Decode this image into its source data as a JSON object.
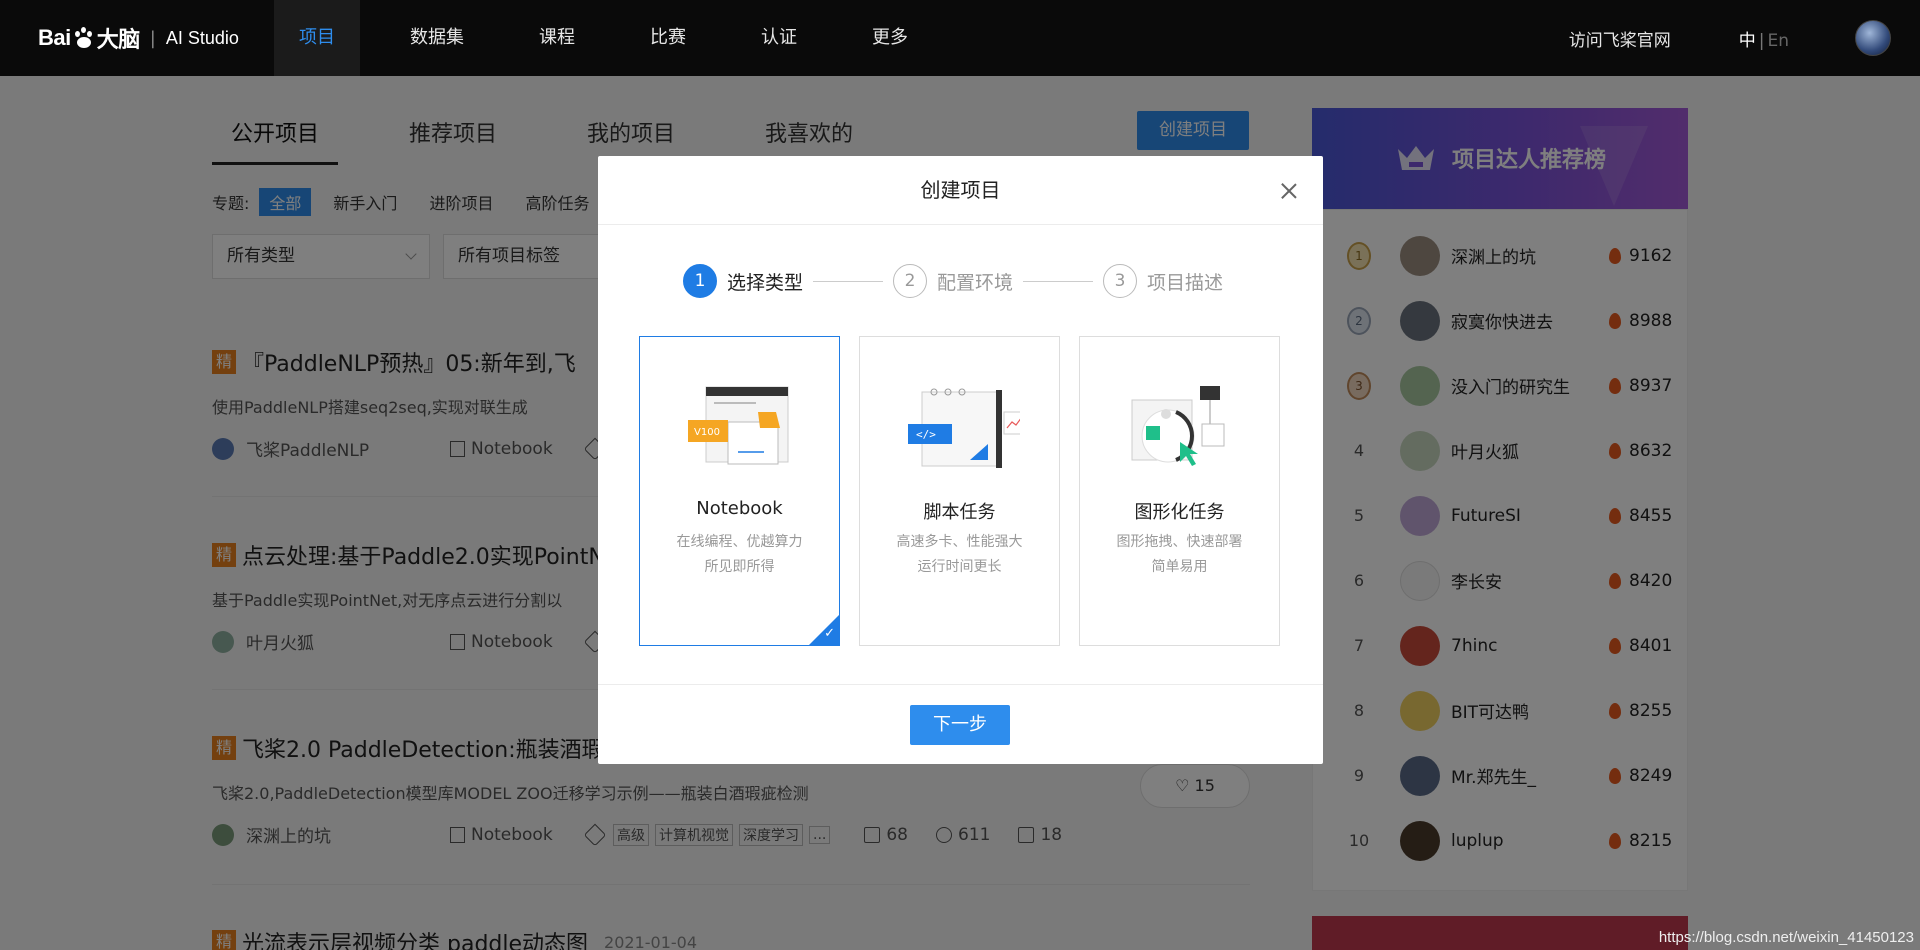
{
  "topnav": {
    "logo_text": "Bai",
    "logo_du": "大脑",
    "logo_sep": "|",
    "logo_studio": "AI Studio",
    "items": [
      "项目",
      "数据集",
      "课程",
      "比赛",
      "认证",
      "更多"
    ],
    "visit_label": "访问飞桨官网",
    "lang_zh": "中",
    "lang_sep": "|",
    "lang_en": "En"
  },
  "main": {
    "tabs": [
      "公开项目",
      "推荐项目",
      "我的项目",
      "我喜欢的"
    ],
    "create_label": "创建项目",
    "filter": {
      "label": "专题:",
      "chips": [
        "全部",
        "新手入门",
        "进阶项目",
        "高阶任务"
      ]
    },
    "select_type": "所有类型",
    "select_tags": "所有项目标签",
    "projects": [
      {
        "badge": "精",
        "title": "『PaddleNLP预热』05:新年到,飞",
        "date": "",
        "desc": "使用PaddleNLP搭建seq2seq,实现对联生成",
        "author": "飞桨PaddleNLP",
        "type": "Notebook"
      },
      {
        "badge": "精",
        "title": "点云处理:基于Paddle2.0实现PointN",
        "date": "",
        "desc": "基于Paddle实现PointNet,对无序点云进行分割以",
        "author": "叶月火狐",
        "type": "Notebook"
      },
      {
        "badge": "精",
        "title": "飞桨2.0 PaddleDetection:瓶装酒瑕",
        "date": "",
        "desc": "飞桨2.0,PaddleDetection模型库MODEL ZOO迁移学习示例——瓶装白酒瑕疵检测",
        "author": "深渊上的坑",
        "type": "Notebook",
        "tags": [
          "高级",
          "计算机视觉",
          "深度学习",
          "..."
        ],
        "forks": "68",
        "views": "611",
        "comments": "18",
        "likes": "15"
      },
      {
        "badge": "精",
        "title": "光流表示层视频分类 paddle动态图",
        "date": "2021-01-04"
      }
    ]
  },
  "leaderboard": {
    "title": "项目达人推荐榜",
    "rows": [
      {
        "rank": "1",
        "name": "深渊上的坑",
        "score": "9162"
      },
      {
        "rank": "2",
        "name": "寂寞你快进去",
        "score": "8988"
      },
      {
        "rank": "3",
        "name": "没入门的研究生",
        "score": "8937"
      },
      {
        "rank": "4",
        "name": "叶月火狐",
        "score": "8632"
      },
      {
        "rank": "5",
        "name": "FutureSI",
        "score": "8455"
      },
      {
        "rank": "6",
        "name": "李长安",
        "score": "8420"
      },
      {
        "rank": "7",
        "name": "7hinc",
        "score": "8401"
      },
      {
        "rank": "8",
        "name": "BIT可达鸭",
        "score": "8255"
      },
      {
        "rank": "9",
        "name": "Mr.郑先生_",
        "score": "8249"
      },
      {
        "rank": "10",
        "name": "luplup",
        "score": "8215"
      }
    ]
  },
  "modal": {
    "title": "创建项目",
    "steps": [
      {
        "num": "1",
        "label": "选择类型"
      },
      {
        "num": "2",
        "label": "配置环境"
      },
      {
        "num": "3",
        "label": "项目描述"
      }
    ],
    "cards": [
      {
        "title": "Notebook",
        "desc1": "在线编程、优越算力",
        "desc2": "所见即所得",
        "badge": "V100"
      },
      {
        "title": "脚本任务",
        "desc1": "高速多卡、性能强大",
        "desc2": "运行时间更长",
        "code": "</>"
      },
      {
        "title": "图形化任务",
        "desc1": "图形拖拽、快速部署",
        "desc2": "简单易用"
      }
    ],
    "next_label": "下一步",
    "accent_color": "#1f7ce4"
  },
  "watermark": "https://blog.csdn.net/weixin_41450123"
}
